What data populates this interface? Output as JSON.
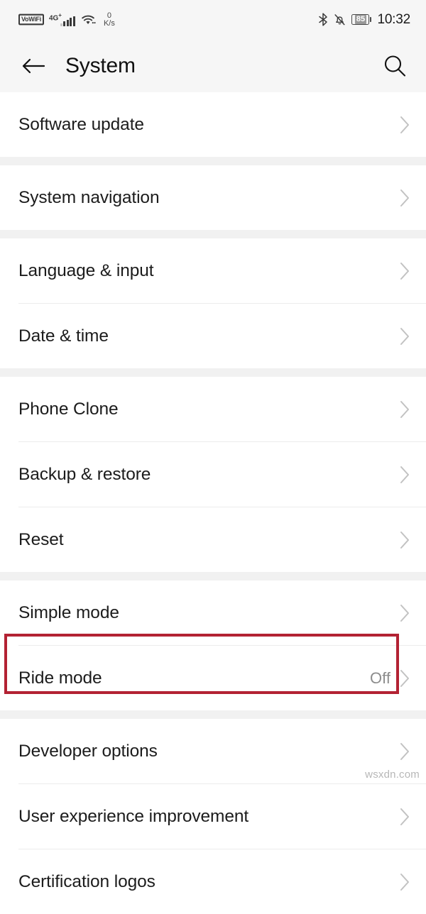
{
  "status_bar": {
    "vowifi_label": "VoWiFi",
    "network_type": "4G",
    "network_type_sup": "+",
    "data_speed_value": "0",
    "data_speed_unit": "K/s",
    "battery_level": "85",
    "time": "10:32",
    "icons": {
      "wifi": "wifi-icon",
      "bluetooth": "bluetooth-icon",
      "silent": "bell-muted-icon",
      "battery": "battery-icon",
      "signal": "signal-bars-icon"
    }
  },
  "header": {
    "title": "System",
    "back_icon": "arrow-left-icon",
    "search_icon": "search-icon"
  },
  "groups": [
    {
      "rows": [
        {
          "label": "Software update",
          "value": ""
        }
      ]
    },
    {
      "rows": [
        {
          "label": "System navigation",
          "value": ""
        }
      ]
    },
    {
      "rows": [
        {
          "label": "Language & input",
          "value": ""
        },
        {
          "label": "Date & time",
          "value": ""
        }
      ]
    },
    {
      "rows": [
        {
          "label": "Phone Clone",
          "value": ""
        },
        {
          "label": "Backup & restore",
          "value": ""
        },
        {
          "label": "Reset",
          "value": ""
        }
      ]
    },
    {
      "rows": [
        {
          "label": "Simple mode",
          "value": ""
        },
        {
          "label": "Ride mode",
          "value": "Off"
        }
      ]
    },
    {
      "rows": [
        {
          "label": "Developer options",
          "value": ""
        },
        {
          "label": "User experience improvement",
          "value": ""
        },
        {
          "label": "Certification logos",
          "value": ""
        }
      ]
    }
  ],
  "annotation": {
    "target": "Developer options",
    "color": "#b32233"
  },
  "watermark": "wsxdn.com",
  "colors": {
    "chrome_bg": "#f6f6f6",
    "list_bg": "#ffffff",
    "gap_bg": "#f1f1f1",
    "label": "#1c1c1c",
    "value": "#8d8d8d",
    "chevron": "#c2c2c2",
    "divider": "#ececec",
    "highlight": "#b32233"
  }
}
